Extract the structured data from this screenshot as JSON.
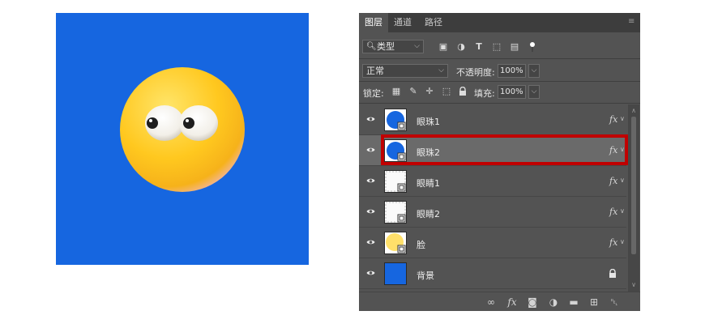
{
  "panel": {
    "tabs": [
      {
        "label": "图层",
        "active": true
      },
      {
        "label": "通道",
        "active": false
      },
      {
        "label": "路径",
        "active": false
      }
    ],
    "filter_kind": "类型",
    "blend_mode": "正常",
    "opacity_label": "不透明度:",
    "opacity_value": "100%",
    "lock_label": "锁定:",
    "fill_label": "填充:",
    "fill_value": "100%",
    "layers": [
      {
        "name": "眼珠1",
        "has_fx": true,
        "selected": false,
        "thumb": "blue-circle"
      },
      {
        "name": "眼珠2",
        "has_fx": true,
        "selected": true,
        "thumb": "blue-circle"
      },
      {
        "name": "眼睛1",
        "has_fx": true,
        "selected": false,
        "thumb": "white"
      },
      {
        "name": "眼睛2",
        "has_fx": true,
        "selected": false,
        "thumb": "white"
      },
      {
        "name": "脸",
        "has_fx": true,
        "selected": false,
        "thumb": "yellow"
      },
      {
        "name": "背景",
        "has_fx": false,
        "locked": true,
        "selected": false,
        "thumb": "blue-fill"
      }
    ],
    "fx_label": "fx"
  },
  "colors": {
    "canvas_bg": "#1666e0",
    "panel_bg": "#535353",
    "selected_row": "#6a6a6a",
    "highlight": "#c00000"
  }
}
